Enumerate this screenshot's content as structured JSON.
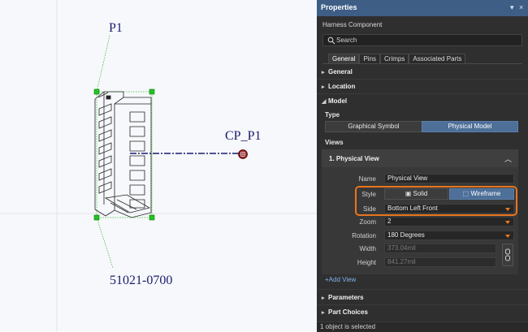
{
  "canvas": {
    "component_designator": "P1",
    "connection_point_label": "CP_P1",
    "part_number": "51021-0700"
  },
  "panel": {
    "title": "Properties",
    "pin_glyph": "▾",
    "close_glyph": "×",
    "subtitle": "Harness Component",
    "search_placeholder": "Search",
    "tabs": [
      "General",
      "Pins",
      "Crimps",
      "Associated Parts"
    ],
    "sections": {
      "general": "General",
      "location": "Location",
      "model": "Model",
      "parameters": "Parameters",
      "part_choices": "Part Choices"
    },
    "model": {
      "type_label": "Type",
      "type_options": [
        "Graphical Symbol",
        "Physical Model"
      ],
      "type_selected": "Physical Model",
      "views_label": "Views",
      "view_title": "1. Physical View",
      "name_label": "Name",
      "name_value": "Physical View",
      "style_label": "Style",
      "style_options": [
        "Solid",
        "Wireframe"
      ],
      "style_selected": "Wireframe",
      "side_label": "Side",
      "side_value": "Bottom Left Front",
      "zoom_label": "Zoom",
      "zoom_value": "2",
      "rotation_label": "Rotation",
      "rotation_value": "180 Degrees",
      "width_label": "Width",
      "width_value": "373.04mil",
      "height_label": "Height",
      "height_value": "841.27mil",
      "add_view": "+Add View"
    },
    "status": "1 object is selected"
  },
  "colors": {
    "panel_bg": "#2f2f2f",
    "titlebar": "#3e5e86",
    "accent_selected": "#4d6f98",
    "highlight_outline": "#e8751e",
    "canvas_text": "#1a1a6e",
    "wire": "#1a1a6e",
    "connection_point": "#8b1a1a",
    "selection_handle": "#22c322"
  }
}
